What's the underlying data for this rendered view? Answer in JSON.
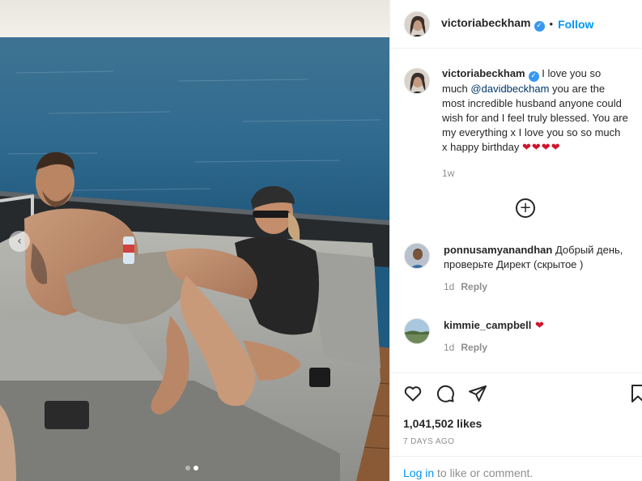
{
  "post": {
    "author": "victoriabeckham",
    "follow_label": "Follow",
    "separator": "•",
    "verified_glyph": "✓",
    "caption": {
      "username": "victoriabeckham",
      "text_before": " I love you so much ",
      "mention": "@davidbeckham",
      "text_after": " you are the most incredible husband anyone could wish for and I feel truly blessed. You are my everything x I love you so so much x happy birthday ",
      "hearts": "❤❤❤❤",
      "time": "1w"
    },
    "load_more_glyph": "+",
    "comments": [
      {
        "username": "ponnusamyanandhan",
        "text": " Добрый день, проверьте Директ (скрытое )",
        "time": "1d",
        "reply_label": "Reply"
      },
      {
        "username": "kimmie_campbell",
        "text": " ❤",
        "time": "1d",
        "reply_label": "Reply"
      }
    ],
    "likes": "1,041,502 likes",
    "posted_ago": "7 DAYS AGO",
    "login_link": "Log in",
    "login_suffix": " to like or comment."
  },
  "carousel": {
    "prev_glyph": "‹",
    "slide_count": 2,
    "active_slide": 2
  },
  "icons": {
    "like": "heart-icon",
    "comment": "comment-bubble-icon",
    "share": "paper-plane-icon",
    "save": "bookmark-icon",
    "verified": "verified-badge-icon",
    "load_more": "plus-circle-icon"
  },
  "colors": {
    "accent": "#0095f6",
    "verified": "#3897f0",
    "heart": "#d0142c",
    "secondary_text": "#8e8e8e",
    "border": "#efefef"
  }
}
